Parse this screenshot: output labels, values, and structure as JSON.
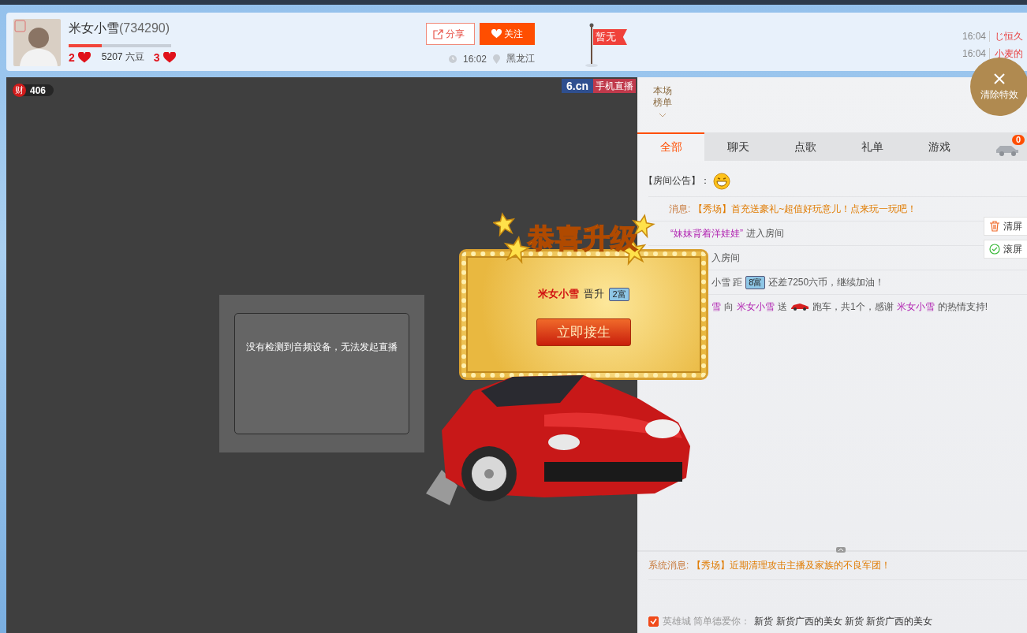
{
  "streamer": {
    "name": "米女小雪",
    "id": "(734290)",
    "level": 0.32,
    "level_from": "2",
    "beans": "5207 六豆",
    "level_to": "3"
  },
  "actions": {
    "share": "分享",
    "follow": "关注",
    "time": "16:02",
    "location": "黑龙江"
  },
  "flag": {
    "label": "暂无"
  },
  "feed": [
    {
      "time": "16:04",
      "text": "じ恒久"
    },
    {
      "time": "16:04",
      "text": "小麦的"
    }
  ],
  "video": {
    "wealth_badge": "财",
    "wealth": "406",
    "logo": "6.cn",
    "logo_tag": "手机直播",
    "notice": "没有检测到音频设备，无法发起直播"
  },
  "popup": {
    "title": "恭喜升级",
    "user": "米女小雪",
    "verb": "晋升",
    "rank": "2富",
    "button": "立即接生"
  },
  "clear_effects": "清除特效",
  "ranking": "本场榜单",
  "tabs": [
    {
      "label": "全部",
      "selected": true
    },
    {
      "label": "聊天",
      "selected": false
    },
    {
      "label": "点歌",
      "selected": false
    },
    {
      "label": "礼单",
      "selected": false
    },
    {
      "label": "游戏",
      "selected": false
    }
  ],
  "car_count": "0",
  "announcement": "【房间公告】：",
  "chat": [
    [
      {
        "kind": "system",
        "text": "消息:"
      },
      {
        "kind": "notice",
        "text": "【秀场】首充送豪礼~超值好玩意儿！点来玩一玩吧！"
      }
    ],
    [
      {
        "kind": "user",
        "text": "“妹妹背着洋娃娃”"
      },
      {
        "kind": "plain",
        "text": "进入房间"
      }
    ],
    [
      {
        "kind": "plain",
        "text": "入房间"
      }
    ],
    [
      {
        "kind": "plain",
        "text": "小雪 距"
      },
      {
        "kind": "badge",
        "text": "8富"
      },
      {
        "kind": "plain",
        "text": "还差7250六币，继续加油！"
      }
    ],
    [
      {
        "kind": "user",
        "text": "雪"
      },
      {
        "kind": "plain",
        "text": "向"
      },
      {
        "kind": "user",
        "text": "米女小雪"
      },
      {
        "kind": "plain",
        "text": "送"
      },
      {
        "kind": "gift"
      },
      {
        "kind": "plain",
        "text": "跑车，共1个，感谢"
      },
      {
        "kind": "user",
        "text": "米女小雪"
      },
      {
        "kind": "plain",
        "text": "的热情支持!"
      }
    ]
  ],
  "side_buttons": [
    {
      "kind": "clear",
      "label": "清屏"
    },
    {
      "kind": "scroll",
      "label": "滚屏"
    }
  ],
  "system_message": [
    {
      "kind": "system",
      "text": "系统消息:"
    },
    {
      "kind": "notice",
      "text": "【秀场】近期清理攻击主播及家族的不良军团！"
    }
  ],
  "bottom_bar": {
    "checked": true,
    "user": "英雄城 简单德爱你：",
    "text": "新货 新货广西的美女 新货 新货广西的美女"
  }
}
